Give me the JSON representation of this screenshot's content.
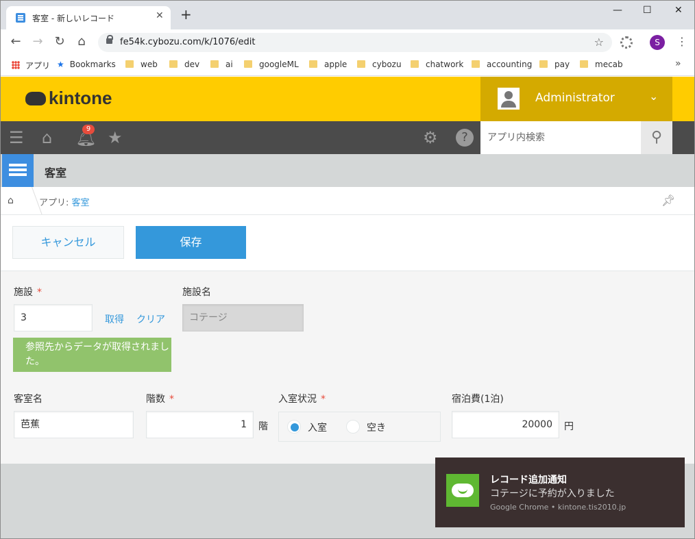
{
  "browser": {
    "tab_title": "客室 - 新しいレコード",
    "new_tab": "+",
    "url": "fe54k.cybozu.com/k/1076/edit",
    "profile_initial": "S",
    "bookmarks": [
      "アプリ",
      "Bookmarks",
      "web",
      "dev",
      "ai",
      "googleML",
      "apple",
      "cybozu",
      "chatwork",
      "accounting",
      "pay",
      "mecab"
    ]
  },
  "header": {
    "logo": "kintone",
    "user": "Administrator",
    "notification_count": "9",
    "search_placeholder": "アプリ内検索"
  },
  "app": {
    "name": "客室",
    "breadcrumb_prefix": "アプリ: ",
    "breadcrumb_link": "客室"
  },
  "actions": {
    "cancel": "キャンセル",
    "save": "保存"
  },
  "form": {
    "facility_label": "施設",
    "facility_value": "3",
    "fetch": "取得",
    "clear": "クリア",
    "facility_name_label": "施設名",
    "facility_name_value": "コテージ",
    "notice": "参照先からデータが取得されました。",
    "room_name_label": "客室名",
    "room_name_value": "芭蕉",
    "floor_label": "階数",
    "floor_value": "1",
    "floor_unit": "階",
    "status_label": "入室状況",
    "status_options": [
      "入室",
      "空き"
    ],
    "status_selected": "入室",
    "fee_label": "宿泊費(1泊)",
    "fee_value": "20000",
    "fee_unit": "円"
  },
  "toast": {
    "title": "レコード追加通知",
    "body": "コテージに予約が入りました",
    "source": "Google Chrome • kintone.tis2010.jp"
  }
}
